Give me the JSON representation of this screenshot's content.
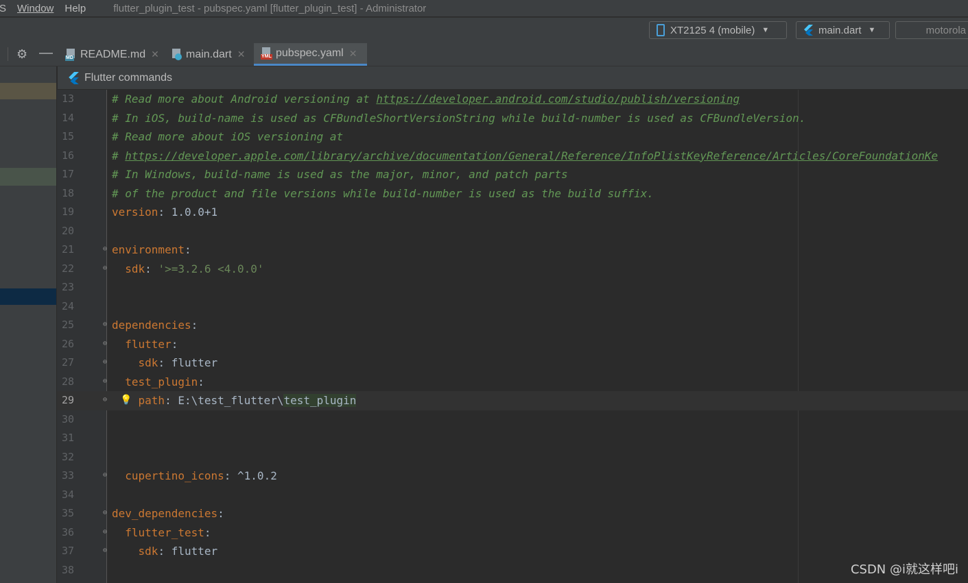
{
  "menu": {
    "items": [
      "S",
      "Window",
      "Help"
    ],
    "title": "flutter_plugin_test - pubspec.yaml [flutter_plugin_test] - Administrator"
  },
  "toolbar": {
    "device": "XT2125 4 (mobile)",
    "run_config": "main.dart",
    "extra_device": "motorola"
  },
  "tabs": [
    {
      "label": "README.md",
      "icon_label": "MD",
      "icon": "markdown-file-icon"
    },
    {
      "label": "main.dart",
      "icon_label": "",
      "icon": "dart-file-icon"
    },
    {
      "label": "pubspec.yaml",
      "icon_label": "YML",
      "icon": "yaml-file-icon"
    }
  ],
  "commands_bar": {
    "label": "Flutter commands"
  },
  "current_line": 29,
  "lines": [
    {
      "n": "13",
      "parts": [
        [
          "com",
          "# Read more about Android versioning at "
        ],
        [
          "link",
          "https://developer.android.com/studio/publish/versioning"
        ]
      ]
    },
    {
      "n": "14",
      "parts": [
        [
          "com",
          "# In iOS, build-name is used as CFBundleShortVersionString while build-number is used as CFBundleVersion."
        ]
      ]
    },
    {
      "n": "15",
      "parts": [
        [
          "com",
          "# Read more about iOS versioning at"
        ]
      ]
    },
    {
      "n": "16",
      "parts": [
        [
          "com",
          "# "
        ],
        [
          "link",
          "https://developer.apple.com/library/archive/documentation/General/Reference/InfoPlistKeyReference/Articles/CoreFoundationKe"
        ]
      ]
    },
    {
      "n": "17",
      "parts": [
        [
          "com",
          "# In Windows, build-name is used as the major, minor, and patch parts"
        ]
      ]
    },
    {
      "n": "18",
      "parts": [
        [
          "com",
          "# of the product and file versions while build-number is used as the build suffix."
        ]
      ]
    },
    {
      "n": "19",
      "parts": [
        [
          "key",
          "version"
        ],
        [
          "plain",
          ": 1.0.0+1"
        ]
      ]
    },
    {
      "n": "20",
      "parts": []
    },
    {
      "n": "21",
      "fold": true,
      "parts": [
        [
          "key",
          "environment"
        ],
        [
          "plain",
          ":"
        ]
      ]
    },
    {
      "n": "22",
      "fold": true,
      "parts": [
        [
          "plain",
          "  "
        ],
        [
          "key",
          "sdk"
        ],
        [
          "plain",
          ": "
        ],
        [
          "str",
          "'>=3.2.6 <4.0.0'"
        ]
      ]
    },
    {
      "n": "23",
      "parts": []
    },
    {
      "n": "24",
      "parts": []
    },
    {
      "n": "25",
      "fold": true,
      "parts": [
        [
          "key",
          "dependencies"
        ],
        [
          "plain",
          ":"
        ]
      ]
    },
    {
      "n": "26",
      "fold": true,
      "parts": [
        [
          "plain",
          "  "
        ],
        [
          "key",
          "flutter"
        ],
        [
          "plain",
          ":"
        ]
      ]
    },
    {
      "n": "27",
      "fold": true,
      "parts": [
        [
          "plain",
          "    "
        ],
        [
          "key",
          "sdk"
        ],
        [
          "plain",
          ": flutter"
        ]
      ]
    },
    {
      "n": "28",
      "fold": true,
      "parts": [
        [
          "plain",
          "  "
        ],
        [
          "key",
          "test_plugin"
        ],
        [
          "plain",
          ":"
        ]
      ]
    },
    {
      "n": "29",
      "fold": true,
      "bulb": true,
      "parts": [
        [
          "plain",
          "    "
        ],
        [
          "key",
          "path"
        ],
        [
          "plain",
          ": E:\\test_flutter\\"
        ],
        [
          "hl",
          "test_plugin"
        ]
      ]
    },
    {
      "n": "30",
      "parts": []
    },
    {
      "n": "31",
      "parts": []
    },
    {
      "n": "32",
      "parts": []
    },
    {
      "n": "33",
      "fold": true,
      "parts": [
        [
          "plain",
          "  "
        ],
        [
          "key",
          "cupertino_icons"
        ],
        [
          "plain",
          ": ^1.0.2"
        ]
      ]
    },
    {
      "n": "34",
      "parts": []
    },
    {
      "n": "35",
      "fold": true,
      "parts": [
        [
          "key",
          "dev_dependencies"
        ],
        [
          "plain",
          ":"
        ]
      ]
    },
    {
      "n": "36",
      "fold": true,
      "parts": [
        [
          "plain",
          "  "
        ],
        [
          "key",
          "flutter_test"
        ],
        [
          "plain",
          ":"
        ]
      ]
    },
    {
      "n": "37",
      "fold": true,
      "parts": [
        [
          "plain",
          "    "
        ],
        [
          "key",
          "sdk"
        ],
        [
          "plain",
          ": flutter"
        ]
      ]
    },
    {
      "n": "38",
      "parts": []
    }
  ],
  "watermark": "CSDN @i就这样吧i",
  "colors": {
    "editor_bg": "#2b2b2b",
    "comment": "#629755",
    "key": "#cc7832",
    "string": "#6a8759",
    "accent": "#4a88c7"
  }
}
